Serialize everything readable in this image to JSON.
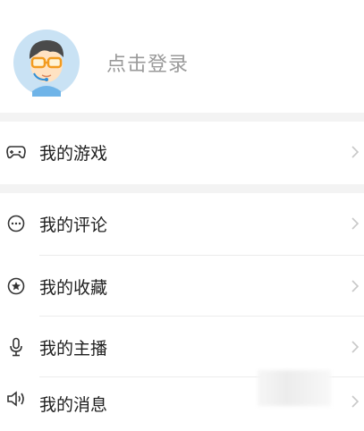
{
  "login": {
    "prompt": "点击登录"
  },
  "menu": {
    "items": [
      {
        "label": "我的游戏",
        "icon": "gamepad-icon"
      },
      {
        "label": "我的评论",
        "icon": "comment-icon"
      },
      {
        "label": "我的收藏",
        "icon": "star-circle-icon"
      },
      {
        "label": "我的主播",
        "icon": "microphone-icon"
      },
      {
        "label": "我的消息",
        "icon": "speaker-icon"
      }
    ]
  },
  "colors": {
    "divider": "#f3f3f3",
    "label": "#1f1f1f",
    "muted": "#9a9a9a",
    "chevron": "#c8c8c8"
  }
}
